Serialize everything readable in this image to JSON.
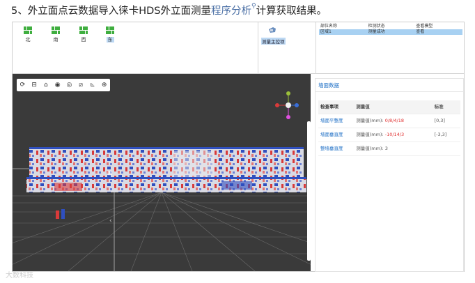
{
  "heading": {
    "pre": "5、外立面点云数据导入徕卡HDS外立面测量",
    "link": "程序分析",
    "post": "计算获取结果。"
  },
  "directions": [
    {
      "label": "北"
    },
    {
      "label": "南"
    },
    {
      "label": "西"
    },
    {
      "label": "东",
      "selected": true
    }
  ],
  "stage": {
    "label": "测量主控项"
  },
  "table1": {
    "headers": [
      "部位名称",
      "检测状态",
      "查看模型"
    ],
    "row": [
      "区域1",
      "测量成功",
      "查看"
    ]
  },
  "viewer": {
    "colors": {
      "background": "#3a3a3a",
      "building_fill": "#d8d8e0",
      "red": "#d83a3a",
      "blue": "#2f4fbf",
      "grid": "#6e6e6e"
    },
    "toolbar_icons": [
      "refresh-icon",
      "minimize-icon",
      "home-icon",
      "eye-icon",
      "layers-icon",
      "ruler-icon",
      "axis-icon",
      "target-icon"
    ]
  },
  "panel": {
    "tab": "墙面数据",
    "headers": [
      "检查事项",
      "测量值",
      "标准"
    ],
    "rows": [
      {
        "item": "墙面平整度",
        "prefix": "测量值(mm): ",
        "values": "0/8/4/18",
        "standard": "[0,3]"
      },
      {
        "item": "墙面垂直度",
        "prefix": "测量值(mm): ",
        "values": "-10/14/3",
        "standard": "[-3,3]"
      },
      {
        "item": "整墙垂直度",
        "prefix": "测量值(mm): ",
        "values": "3",
        "standard": ""
      }
    ]
  },
  "watermark": "大数科技"
}
